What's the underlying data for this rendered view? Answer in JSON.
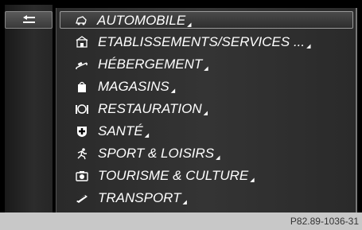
{
  "menu": {
    "items": [
      {
        "label": "AUTOMOBILE",
        "icon": "car-icon",
        "selected": true
      },
      {
        "label": "ETABLISSEMENTS/SERVICES ...",
        "icon": "building-icon"
      },
      {
        "label": "HÉBERGEMENT",
        "icon": "bed-icon"
      },
      {
        "label": "MAGASINS",
        "icon": "shopping-bag-icon"
      },
      {
        "label": "RESTAURATION",
        "icon": "cutlery-icon"
      },
      {
        "label": "SANTÉ",
        "icon": "medical-cross-icon"
      },
      {
        "label": "SPORT & LOISIRS",
        "icon": "sport-icon"
      },
      {
        "label": "TOURISME & CULTURE",
        "icon": "camera-icon"
      },
      {
        "label": "TRANSPORT",
        "icon": "train-icon"
      }
    ]
  },
  "footer": {
    "code": "P82.89-1036-31"
  },
  "colors": {
    "background": "#000000",
    "list": "#303030",
    "text": "#ffffff",
    "footer": "#c8c8c8"
  }
}
